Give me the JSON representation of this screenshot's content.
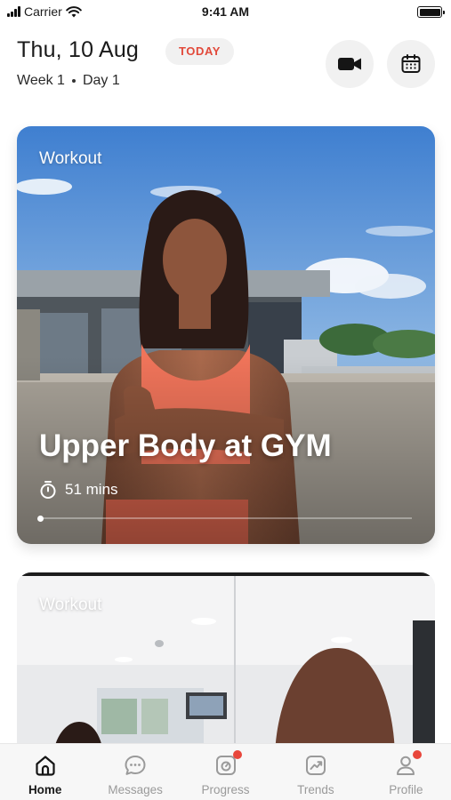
{
  "status_bar": {
    "carrier": "Carrier",
    "time": "9:41 AM",
    "battery_level": 1.0
  },
  "header": {
    "date": "Thu, 10 Aug",
    "today_badge": "TODAY",
    "week": "Week 1",
    "day": "Day 1",
    "icons": {
      "video": "video-camera-icon",
      "calendar": "calendar-icon"
    }
  },
  "cards": [
    {
      "label": "Workout",
      "title": "Upper Body at GYM",
      "duration": "51 mins",
      "progress": 0.0
    },
    {
      "label": "Workout"
    }
  ],
  "tab_bar": {
    "items": [
      {
        "label": "Home",
        "icon": "home-icon",
        "active": true,
        "badge": false
      },
      {
        "label": "Messages",
        "icon": "chat-icon",
        "active": false,
        "badge": false
      },
      {
        "label": "Progress",
        "icon": "scale-icon",
        "active": false,
        "badge": true
      },
      {
        "label": "Trends",
        "icon": "trend-chart-icon",
        "active": false,
        "badge": false
      },
      {
        "label": "Profile",
        "icon": "profile-icon",
        "active": false,
        "badge": true
      }
    ]
  },
  "colors": {
    "accent": "#e24a3b",
    "badge_dot": "#e8463b",
    "chip_bg": "#f1f1f1"
  }
}
